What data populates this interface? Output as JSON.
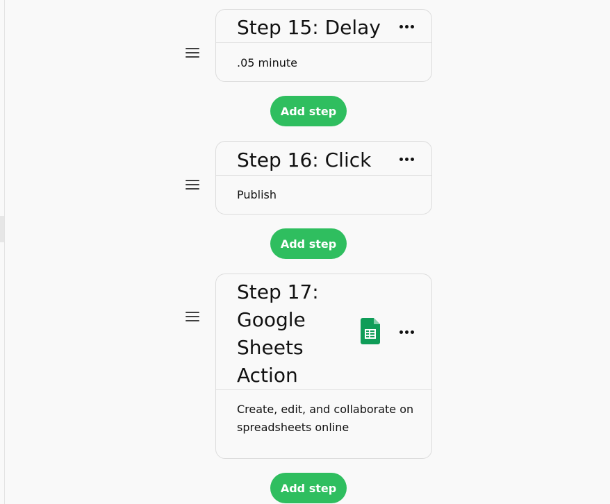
{
  "steps": [
    {
      "title": "Step 15: Delay",
      "description": ".05 minute"
    },
    {
      "title": "Step 16: Click",
      "description": "Publish"
    },
    {
      "title_lines": [
        "Step 17:",
        "Google",
        "Sheets",
        "Action"
      ],
      "description_lines": [
        "Create, edit, and collaborate on",
        "spreadsheets online"
      ],
      "icon": "google-sheets-icon"
    }
  ],
  "add_step_label": "Add step",
  "colors": {
    "add_step_bg": "#2fbe5f",
    "sheets_green": "#0f9d58"
  }
}
